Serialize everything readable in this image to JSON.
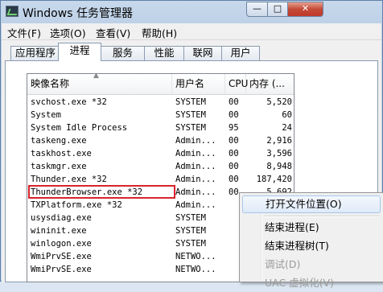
{
  "window": {
    "title": "Windows 任务管理器"
  },
  "controls": {
    "minimize": "—",
    "maximize": "□",
    "close": "✕"
  },
  "menu": [
    "文件(F)",
    "选项(O)",
    "查看(V)",
    "帮助(H)"
  ],
  "tabs": [
    "应用程序",
    "进程",
    "服务",
    "性能",
    "联网",
    "用户"
  ],
  "active_tab": "进程",
  "columns": {
    "name": "映像名称",
    "user": "用户名",
    "cpu": "CPU",
    "mem": "内存 (..."
  },
  "rows": [
    {
      "name": "svchost.exe *32",
      "user": "SYSTEM",
      "cpu": "00",
      "mem": "5,520"
    },
    {
      "name": "System",
      "user": "SYSTEM",
      "cpu": "00",
      "mem": "60"
    },
    {
      "name": "System Idle Process",
      "user": "SYSTEM",
      "cpu": "95",
      "mem": "24"
    },
    {
      "name": "taskeng.exe",
      "user": "Admin...",
      "cpu": "00",
      "mem": "2,916"
    },
    {
      "name": "taskhost.exe",
      "user": "Admin...",
      "cpu": "00",
      "mem": "3,596"
    },
    {
      "name": "taskmgr.exe",
      "user": "Admin...",
      "cpu": "00",
      "mem": "8,948"
    },
    {
      "name": "Thunder.exe *32",
      "user": "Admin...",
      "cpu": "00",
      "mem": "187,420"
    },
    {
      "name": "ThunderBrowser.exe *32",
      "user": "Admin...",
      "cpu": "00",
      "mem": "5,692"
    },
    {
      "name": "TXPlatform.exe *32",
      "user": "Admin...",
      "cpu": "",
      "mem": ""
    },
    {
      "name": "usysdiag.exe",
      "user": "SYSTEM",
      "cpu": "",
      "mem": ""
    },
    {
      "name": "wininit.exe",
      "user": "SYSTEM",
      "cpu": "",
      "mem": ""
    },
    {
      "name": "winlogon.exe",
      "user": "SYSTEM",
      "cpu": "",
      "mem": ""
    },
    {
      "name": "WmiPrvSE.exe",
      "user": "NETWO...",
      "cpu": "",
      "mem": ""
    },
    {
      "name": "WmiPrvSE.exe",
      "user": "NETWO...",
      "cpu": "",
      "mem": ""
    }
  ],
  "highlighted_row": "ThunderBrowser.exe *32",
  "context_menu": {
    "items": [
      {
        "label": "打开文件位置(O)",
        "state": "hover"
      },
      {
        "label": "结束进程(E)",
        "state": "normal"
      },
      {
        "label": "结束进程树(T)",
        "state": "normal"
      },
      {
        "label": "调试(D)",
        "state": "disabled"
      },
      {
        "label": "UAC 虚拟化(V)",
        "state": "disabled"
      }
    ]
  },
  "colors": {
    "highlight_box": "#d8242b",
    "close_button": "#c44a36"
  }
}
